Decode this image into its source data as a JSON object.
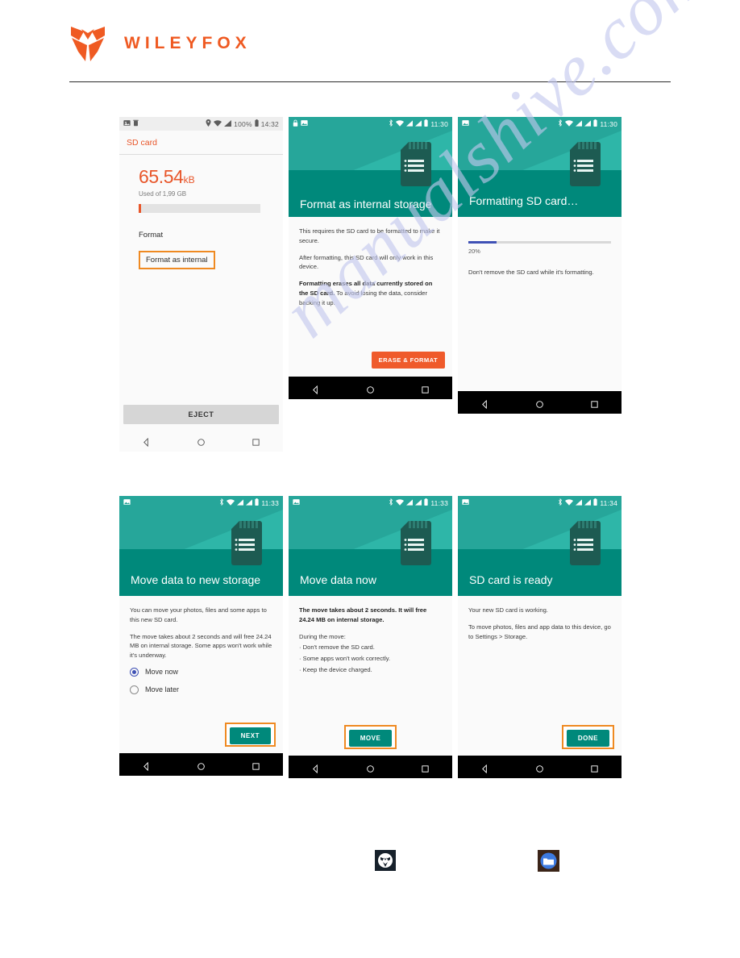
{
  "brand": {
    "name": "WILEYFOX",
    "logo_icon": "wileyfox-fox-logo",
    "accent_color": "#ef5a22"
  },
  "watermark": {
    "text": "manualshive.com"
  },
  "theme": {
    "teal_light": "#26a69a",
    "teal_dark": "#00897b",
    "orange": "#ef5a2b",
    "highlight_orange": "#ef8a22",
    "progress_blue": "#3f51b5"
  },
  "screens": [
    {
      "id": "sd-card-settings",
      "statusbar": {
        "time": "14:32",
        "battery": "100%",
        "left_icons": [
          "screenshot-icon",
          "trash-icon"
        ],
        "right_icons": [
          "location-icon",
          "wifi-icon",
          "signal-icon",
          "battery-icon"
        ]
      },
      "appbar_title": "SD card",
      "size_value": "65.54",
      "size_unit": "kB",
      "used_of": "Used of 1,99 GB",
      "format_label": "Format",
      "format_internal_label": "Format as internal",
      "eject_label": "EJECT"
    },
    {
      "id": "format-as-internal-storage",
      "statusbar": {
        "time": "11:30",
        "left_icons": [
          "lock-icon",
          "screenshot-icon"
        ],
        "right_icons": [
          "bluetooth-icon",
          "wifi-icon",
          "signal-icon",
          "signal-icon",
          "battery-icon"
        ]
      },
      "title": "Format as internal storage",
      "paragraphs": [
        "This requires the SD card to be formatted to make it secure.",
        "After formatting, this SD card will only work in this device."
      ],
      "warning_bold": "Formatting erases all data currently stored on the SD card.",
      "warning_rest": " To avoid losing the data, consider backing it up.",
      "button_label": "ERASE & FORMAT"
    },
    {
      "id": "formatting-sd-card",
      "statusbar": {
        "time": "11:30",
        "left_icons": [
          "screenshot-icon"
        ],
        "right_icons": [
          "bluetooth-icon",
          "wifi-icon",
          "signal-icon",
          "signal-icon",
          "battery-icon"
        ]
      },
      "title": "Formatting SD card…",
      "progress_percent": 20,
      "progress_label": "20%",
      "note": "Don't remove the SD card while it's formatting."
    },
    {
      "id": "move-data-to-new-storage",
      "statusbar": {
        "time": "11:33",
        "left_icons": [
          "screenshot-icon"
        ],
        "right_icons": [
          "bluetooth-icon",
          "wifi-icon",
          "signal-icon",
          "signal-icon",
          "battery-icon"
        ]
      },
      "title": "Move data to new storage",
      "paragraphs": [
        "You can move your photos, files and some apps to this new SD card.",
        "The move takes about 2 seconds and will free 24.24 MB on internal storage. Some apps won't work while it's underway."
      ],
      "options": [
        {
          "label": "Move now",
          "selected": true
        },
        {
          "label": "Move later",
          "selected": false
        }
      ],
      "button_label": "NEXT"
    },
    {
      "id": "move-data-now",
      "statusbar": {
        "time": "11:33",
        "left_icons": [
          "screenshot-icon"
        ],
        "right_icons": [
          "bluetooth-icon",
          "wifi-icon",
          "signal-icon",
          "signal-icon",
          "battery-icon"
        ]
      },
      "title": "Move data now",
      "lead_bold": "The move takes about 2 seconds. It will free 24.24 MB on internal storage.",
      "list_heading": "During the move:",
      "list_items": [
        "· Don't remove the SD card.",
        "· Some apps won't work correctly.",
        "· Keep the device charged."
      ],
      "button_label": "MOVE"
    },
    {
      "id": "sd-card-is-ready",
      "statusbar": {
        "time": "11:34",
        "left_icons": [
          "screenshot-icon"
        ],
        "right_icons": [
          "bluetooth-icon",
          "wifi-icon",
          "signal-icon",
          "signal-icon",
          "battery-icon"
        ]
      },
      "title": "SD card is ready",
      "paragraphs": [
        "Your new SD card is working.",
        "To move photos, files and app data to this device, go to Settings > Storage."
      ],
      "button_label": "DONE"
    }
  ],
  "navbar": {
    "back_icon": "back-triangle-icon",
    "home_icon": "home-circle-icon",
    "recents_icon": "recents-square-icon"
  },
  "app_icons": [
    {
      "name": "wileyfox-app-icon",
      "glyph": "fox-face"
    },
    {
      "name": "file-manager-app-icon",
      "glyph": "folder"
    }
  ]
}
